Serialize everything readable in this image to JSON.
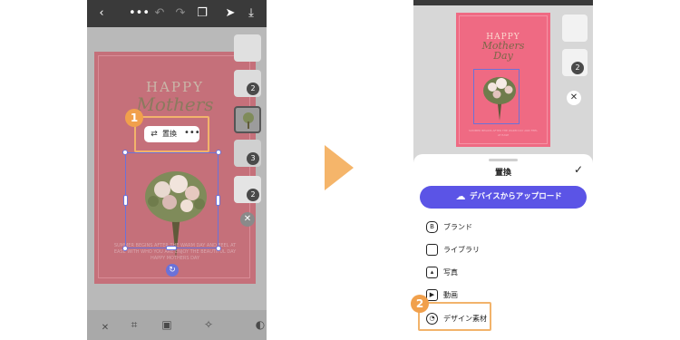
{
  "left_screen": {
    "toolbar_icons": [
      "back-chevron-icon",
      "more-dots-icon",
      "undo-icon",
      "redo-icon",
      "layers-icon",
      "send-icon",
      "download-icon"
    ],
    "card": {
      "heading": "HAPPY",
      "script": "Mothers",
      "body_text": "SUMMER BEGINS AFTER THE WARM DAY AND FEEL AT EASE WITH WHO YOU ARE ENJOY THE BEAUTIFUL DAY HAPPY MOTHERS DAY"
    },
    "thumb_badges": [
      "2",
      "3",
      "2"
    ],
    "popup": {
      "label": "置換"
    },
    "step_badge": "1",
    "bottom_icons": [
      "close-icon",
      "crop-icon",
      "image-icon",
      "effects-icon",
      "adjust-icon"
    ]
  },
  "right_screen": {
    "card": {
      "heading": "HAPPY",
      "script_line1": "Mothers",
      "script_line2": "Day",
      "body_text": "SUMMER BEGINS AFTER THE WARM DAY AND FEEL AT EASE"
    },
    "thumb_badge": "2",
    "sheet": {
      "title": "置換",
      "upload_label": "デバイスからアップロード",
      "items": [
        {
          "label": "ブランド",
          "icon": "brand-icon"
        },
        {
          "label": "ライブラリ",
          "icon": "folder-icon"
        },
        {
          "label": "写真",
          "icon": "photo-icon"
        },
        {
          "label": "動画",
          "icon": "video-icon"
        },
        {
          "label": "デザイン素材",
          "icon": "design-asset-icon"
        }
      ]
    },
    "step_badge": "2"
  },
  "colors": {
    "accent_orange": "#f5b56a",
    "button_purple": "#5b54e6",
    "selection_blue": "#6b72d8",
    "card_pink": "#ef6a83"
  }
}
